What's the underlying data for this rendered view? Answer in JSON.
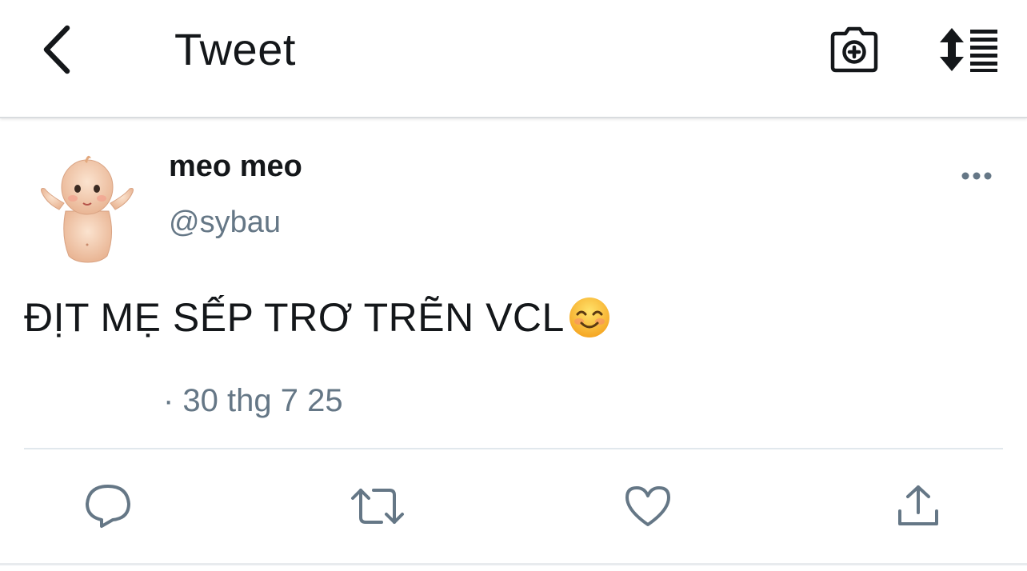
{
  "nav": {
    "title": "Tweet",
    "back_icon": "chevron-left-icon",
    "camera_icon": "camera-plus-icon",
    "sort_icon": "sort-list-icon"
  },
  "tweet": {
    "display_name": "meo meo",
    "handle": "@sybau",
    "text": "ĐỊT MẸ SẾP TRƠ TRẼN VCL",
    "emoji": "smiling-face-emoji",
    "timestamp": "· 30 thg 7 25",
    "more_icon": "more-dots-icon"
  },
  "actions": {
    "reply": "reply-icon",
    "retweet": "retweet-icon",
    "like": "heart-icon",
    "share": "share-icon"
  },
  "colors": {
    "text": "#14171a",
    "secondary": "#657786",
    "icon": "#657786",
    "divider": "#e1e8ed"
  }
}
